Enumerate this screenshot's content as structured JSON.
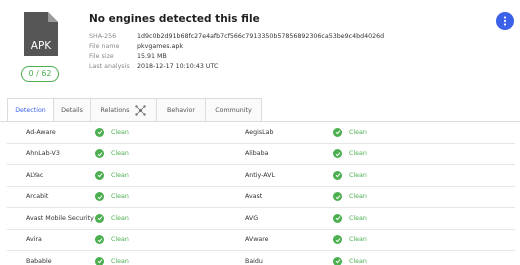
{
  "summary": {
    "file_type_label": "APK",
    "score": "0 / 62",
    "headline": "No engines detected this file",
    "details": [
      {
        "key": "SHA-256",
        "value": "1d9c0b2d91b68fc27e4afb7cf566c7913350b57856892306ca53be9c4bd4026d"
      },
      {
        "key": "File name",
        "value": "pkvgames.apk"
      },
      {
        "key": "File size",
        "value": "15.91 MB"
      },
      {
        "key": "Last analysis",
        "value": "2018-12-17 10:10:43 UTC"
      }
    ]
  },
  "tabs": [
    {
      "label": "Detection"
    },
    {
      "label": "Details"
    },
    {
      "label": "Relations"
    },
    {
      "label": "Behavior"
    },
    {
      "label": "Community"
    }
  ],
  "results": [
    {
      "left_engine": "Ad-Aware",
      "left_result": "Clean",
      "right_engine": "AegisLab",
      "right_result": "Clean"
    },
    {
      "left_engine": "AhnLab-V3",
      "left_result": "Clean",
      "right_engine": "Alibaba",
      "right_result": "Clean"
    },
    {
      "left_engine": "ALYac",
      "left_result": "Clean",
      "right_engine": "Antiy-AVL",
      "right_result": "Clean"
    },
    {
      "left_engine": "Arcabit",
      "left_result": "Clean",
      "right_engine": "Avast",
      "right_result": "Clean"
    },
    {
      "left_engine": "Avast Mobile Security",
      "left_result": "Clean",
      "right_engine": "AVG",
      "right_result": "Clean"
    },
    {
      "left_engine": "Avira",
      "left_result": "Clean",
      "right_engine": "AVware",
      "right_result": "Clean"
    },
    {
      "left_engine": "Babable",
      "left_result": "Clean",
      "right_engine": "Baidu",
      "right_result": "Clean"
    }
  ],
  "colors": {
    "accent": "#3b61e8",
    "clean": "#4caf50"
  }
}
